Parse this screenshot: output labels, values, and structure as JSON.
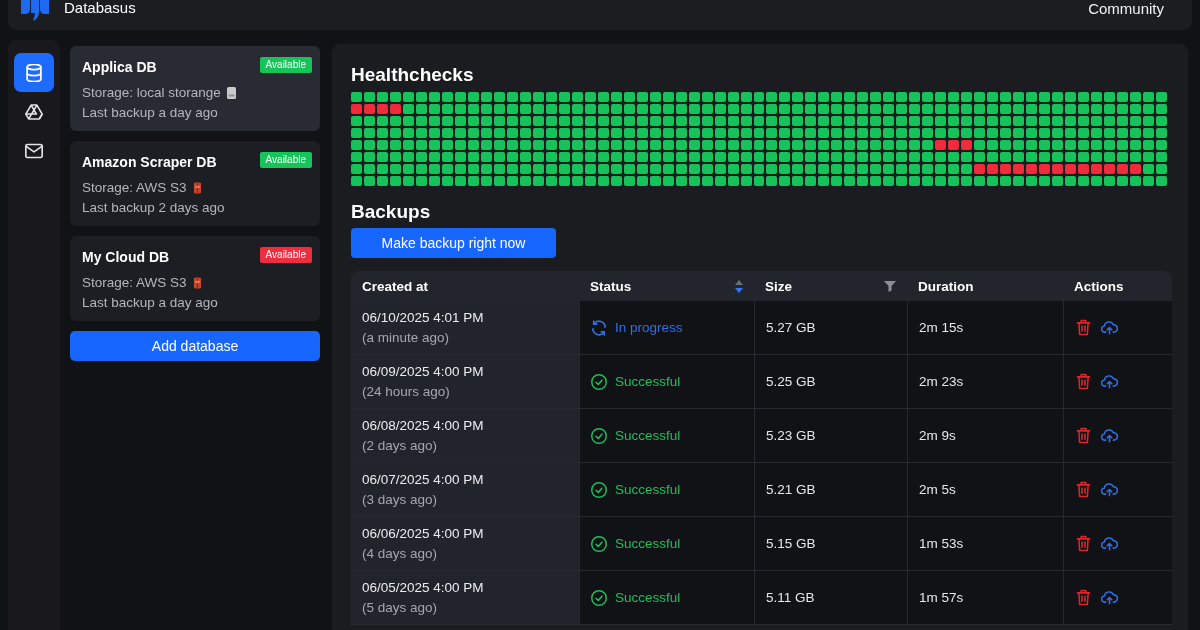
{
  "header": {
    "app_name": "Databasus",
    "links": [
      "Community"
    ]
  },
  "rail": [
    {
      "kind": "database",
      "selected": true
    },
    {
      "kind": "triangle",
      "selected": false
    },
    {
      "kind": "mail",
      "selected": false
    }
  ],
  "databases": [
    {
      "name": "Applica DB",
      "badge": {
        "text": "Available",
        "color": "#15c55a"
      },
      "storage": "Storage: local storange",
      "kind": "local",
      "last_backup": "Last backup a day ago",
      "selected": true
    },
    {
      "name": "Amazon Scraper DB",
      "badge": {
        "text": "Available",
        "color": "#15c55a"
      },
      "storage": "Storage: AWS S3",
      "kind": "s3",
      "last_backup": "Last backup 2 days ago",
      "selected": false
    },
    {
      "name": "My Cloud DB",
      "badge": {
        "text": "Available",
        "color": "#ee2e3f"
      },
      "storage": "Storage: AWS S3",
      "kind": "s3",
      "last_backup": "Last backup a day ago",
      "selected": false
    }
  ],
  "add_database_button": "Add database",
  "healthchecks": {
    "title": "Healthchecks",
    "rows": [
      [
        true,
        true,
        true,
        true,
        true,
        true,
        true,
        true,
        true,
        true,
        true,
        true,
        true,
        true,
        true,
        true,
        true,
        true,
        true,
        true,
        true,
        true,
        true,
        true,
        true,
        true,
        true,
        true,
        true,
        true,
        true,
        true,
        true,
        true,
        true,
        true,
        true,
        true,
        true,
        true,
        true,
        true,
        true,
        true,
        true,
        true,
        true,
        true,
        true,
        true,
        true,
        true,
        true,
        true,
        true,
        true,
        true,
        true,
        true,
        true,
        true,
        true,
        true
      ],
      [
        false,
        false,
        false,
        false,
        true,
        true,
        true,
        true,
        true,
        true,
        true,
        true,
        true,
        true,
        true,
        true,
        true,
        true,
        true,
        true,
        true,
        true,
        true,
        true,
        true,
        true,
        true,
        true,
        true,
        true,
        true,
        true,
        true,
        true,
        true,
        true,
        true,
        true,
        true,
        true,
        true,
        true,
        true,
        true,
        true,
        true,
        true,
        true,
        true,
        true,
        true,
        true,
        true,
        true,
        true,
        true,
        true,
        true,
        true,
        true,
        true,
        true,
        true
      ],
      [
        true,
        true,
        true,
        true,
        true,
        true,
        true,
        true,
        true,
        true,
        true,
        true,
        true,
        true,
        true,
        true,
        true,
        true,
        true,
        true,
        true,
        true,
        true,
        true,
        true,
        true,
        true,
        true,
        true,
        true,
        true,
        true,
        true,
        true,
        true,
        true,
        true,
        true,
        true,
        true,
        true,
        true,
        true,
        true,
        true,
        true,
        true,
        true,
        true,
        true,
        true,
        true,
        true,
        true,
        true,
        true,
        true,
        true,
        true,
        true,
        true,
        true,
        true
      ],
      [
        true,
        true,
        true,
        true,
        true,
        true,
        true,
        true,
        true,
        true,
        true,
        true,
        true,
        true,
        true,
        true,
        true,
        true,
        true,
        true,
        true,
        true,
        true,
        true,
        true,
        true,
        true,
        true,
        true,
        true,
        true,
        true,
        true,
        true,
        true,
        true,
        true,
        true,
        true,
        true,
        true,
        true,
        true,
        true,
        true,
        true,
        true,
        true,
        true,
        true,
        true,
        true,
        true,
        true,
        true,
        true,
        true,
        true,
        true,
        true,
        true,
        true,
        true
      ],
      [
        true,
        true,
        true,
        true,
        true,
        true,
        true,
        true,
        true,
        true,
        true,
        true,
        true,
        true,
        true,
        true,
        true,
        true,
        true,
        true,
        true,
        true,
        true,
        true,
        true,
        true,
        true,
        true,
        true,
        true,
        true,
        true,
        true,
        true,
        true,
        true,
        true,
        true,
        true,
        true,
        true,
        true,
        true,
        true,
        true,
        false,
        false,
        false,
        true,
        true,
        true,
        true,
        true,
        true,
        true,
        true,
        true,
        true,
        true,
        true,
        true,
        true,
        true
      ],
      [
        true,
        true,
        true,
        true,
        true,
        true,
        true,
        true,
        true,
        true,
        true,
        true,
        true,
        true,
        true,
        true,
        true,
        true,
        true,
        true,
        true,
        true,
        true,
        true,
        true,
        true,
        true,
        true,
        true,
        true,
        true,
        true,
        true,
        true,
        true,
        true,
        true,
        true,
        true,
        true,
        true,
        true,
        true,
        true,
        true,
        true,
        true,
        true,
        true,
        true,
        true,
        true,
        true,
        true,
        true,
        true,
        true,
        true,
        true,
        true,
        true,
        true,
        true
      ],
      [
        true,
        true,
        true,
        true,
        true,
        true,
        true,
        true,
        true,
        true,
        true,
        true,
        true,
        true,
        true,
        true,
        true,
        true,
        true,
        true,
        true,
        true,
        true,
        true,
        true,
        true,
        true,
        true,
        true,
        true,
        true,
        true,
        true,
        true,
        true,
        true,
        true,
        true,
        true,
        true,
        true,
        true,
        true,
        true,
        true,
        true,
        true,
        true,
        false,
        false,
        false,
        false,
        false,
        false,
        false,
        false,
        false,
        false,
        false,
        false,
        false,
        true,
        true
      ],
      [
        true,
        true,
        true,
        true,
        true,
        true,
        true,
        true,
        true,
        true,
        true,
        true,
        true,
        true,
        true,
        true,
        true,
        true,
        true,
        true,
        true,
        true,
        true,
        true,
        true,
        true,
        true,
        true,
        true,
        true,
        true,
        true,
        true,
        true,
        true,
        true,
        true,
        true,
        true,
        true,
        true,
        true,
        true,
        true,
        true,
        true,
        true,
        true,
        true,
        true,
        true,
        true,
        true,
        true,
        true,
        true,
        true,
        true,
        true,
        true,
        true,
        true,
        true
      ]
    ]
  },
  "backups": {
    "title": "Backups",
    "make_backup_button": "Make backup right now",
    "table": {
      "columns": [
        {
          "label": "Created at"
        },
        {
          "label": "Status",
          "sortable": true,
          "sorted_descending": true
        },
        {
          "label": "Size",
          "filterable": true
        },
        {
          "label": "Duration"
        },
        {
          "label": "Actions"
        }
      ],
      "rows": [
        {
          "created": "06/10/2025 4:01 PM",
          "created_relative": "(a minute ago)",
          "status": {
            "kind": "in_progress",
            "text": "In progress"
          },
          "size": "5.27 GB",
          "duration": "2m 15s"
        },
        {
          "created": "06/09/2025 4:00 PM",
          "created_relative": "(24 hours ago)",
          "status": {
            "kind": "success",
            "text": "Successful"
          },
          "size": "5.25 GB",
          "duration": "2m 23s"
        },
        {
          "created": "06/08/2025 4:00 PM",
          "created_relative": "(2 days ago)",
          "status": {
            "kind": "success",
            "text": "Successful"
          },
          "size": "5.23 GB",
          "duration": "2m 9s"
        },
        {
          "created": "06/07/2025 4:00 PM",
          "created_relative": "(3 days ago)",
          "status": {
            "kind": "success",
            "text": "Successful"
          },
          "size": "5.21 GB",
          "duration": "2m 5s"
        },
        {
          "created": "06/06/2025 4:00 PM",
          "created_relative": "(4 days ago)",
          "status": {
            "kind": "success",
            "text": "Successful"
          },
          "size": "5.15 GB",
          "duration": "1m 53s"
        },
        {
          "created": "06/05/2025 4:00 PM",
          "created_relative": "(5 days ago)",
          "status": {
            "kind": "success",
            "text": "Successful"
          },
          "size": "5.11 GB",
          "duration": "1m 57s"
        }
      ]
    }
  }
}
